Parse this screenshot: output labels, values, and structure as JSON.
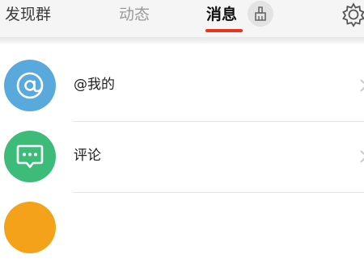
{
  "tabs": {
    "discover": "发现群",
    "feed": "动态",
    "messages": "消息"
  },
  "active_tab": "messages",
  "icons": {
    "clean": "broom-icon",
    "settings": "gear-icon",
    "mentions": "at-sign-icon",
    "comments": "chat-bubble-icon"
  },
  "colors": {
    "accent": "#e8341c",
    "mentions_avatar": "#5aa9dd",
    "comments_avatar": "#3dbb78",
    "third_avatar": "#f5a21b"
  },
  "messages_list": {
    "items": [
      {
        "label": "@我的"
      },
      {
        "label": "评论"
      }
    ]
  }
}
